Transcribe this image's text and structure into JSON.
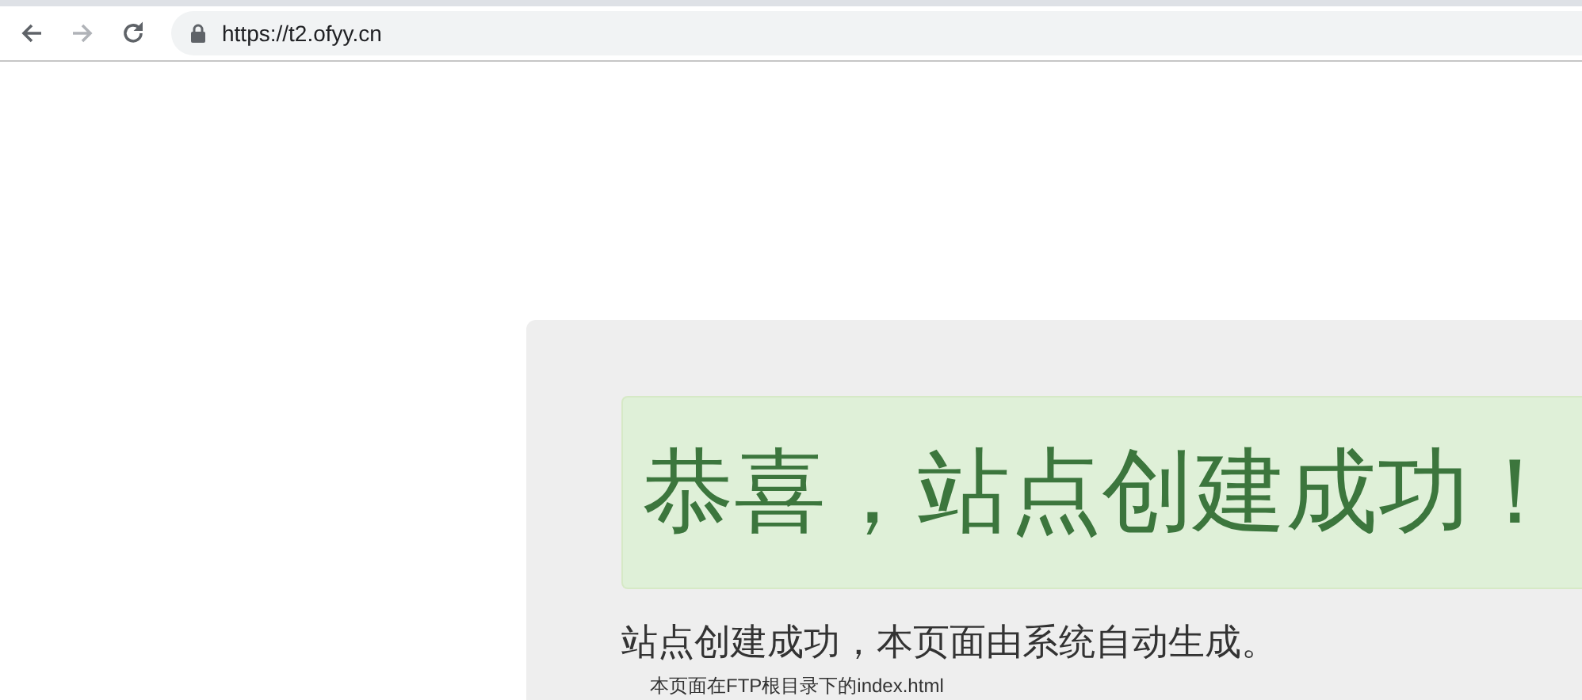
{
  "browser": {
    "nav": [
      {
        "kind": "back",
        "disabled": false
      },
      {
        "kind": "forward",
        "disabled": true
      },
      {
        "kind": "reload",
        "disabled": false
      }
    ],
    "url": "https://t2.ofyy.cn"
  },
  "page": {
    "alert_title": "恭喜，站点创建成功！",
    "subtitle": "站点创建成功，本页面由系统自动生成。",
    "note": "本页面在FTP根目录下的index.html"
  }
}
